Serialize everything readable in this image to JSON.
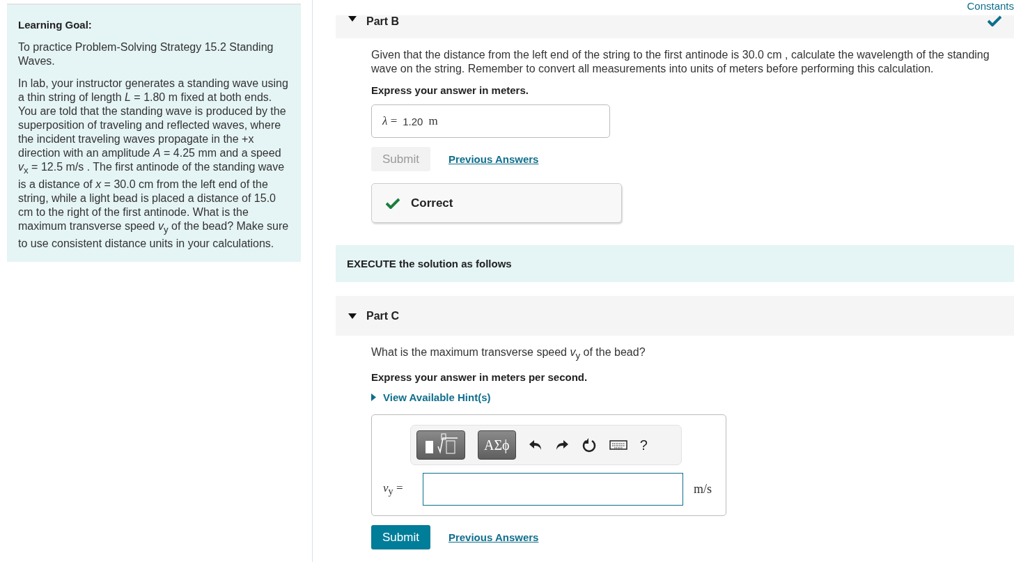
{
  "learning_goal": {
    "title": "Learning Goal:",
    "paragraphs": [
      "To practice Problem-Solving Strategy 15.2 Standing Waves.",
      "In lab, your instructor generates a standing wave using a thin string of length *L* = 1.80 m fixed at both ends. You are told that the standing wave is produced by the superposition of traveling and reflected waves, where the incident traveling waves propagate in the +x direction with an amplitude *A* = 4.25 mm and a speed *v*$_{x}$ = 12.5 m/s . The first antinode of the standing wave is a distance of *x* = 30.0 cm from the left end of the string, while a light bead is placed a distance of 15.0 cm to the right of the first antinode. What is the maximum transverse speed *v*$_{y}$ of the bead? Make sure to use consistent distance units in your calculations."
    ]
  },
  "constants_link": "Constants",
  "sections": [
    {
      "kind": "part",
      "label": "Part B",
      "expanded": true,
      "completed": true,
      "question": "Given that the distance from the left end of the string to the first antinode is 30.0 cm , calculate the wavelength of the standing wave on the string. Remember to convert all measurements into units of meters before performing this calculation.",
      "instruction": "Express your answer in meters.",
      "answer": {
        "variable": "*λ* =",
        "value": "1.20",
        "unit": "m"
      },
      "submit": {
        "label": "Submit",
        "disabled": true
      },
      "previous_answers": "Previous Answers",
      "feedback": "Correct"
    },
    {
      "kind": "banner",
      "text": "EXECUTE the solution as follows"
    },
    {
      "kind": "part",
      "label": "Part C",
      "expanded": true,
      "completed": false,
      "question": "What is the maximum transverse speed *v*$_{y}$ of the bead?",
      "instruction": "Express your answer in meters per second.",
      "hint_link": "View Available Hint(s)",
      "toolbar": {
        "symbols_label": "ΑΣϕ",
        "help_label": "?"
      },
      "answer": {
        "variable": "*v*$_{y}$ =",
        "unit": "m/s"
      },
      "submit": {
        "label": "Submit",
        "disabled": false
      },
      "previous_answers": "Previous Answers"
    }
  ]
}
